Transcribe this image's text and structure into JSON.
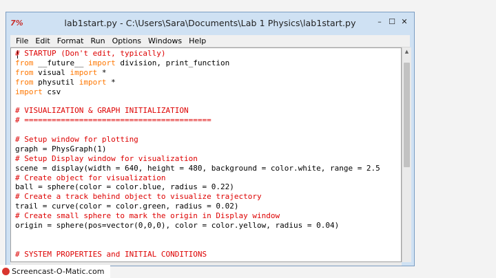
{
  "window": {
    "title": "lab1start.py - C:\\Users\\Sara\\Documents\\Lab 1 Physics\\lab1start.py",
    "app_icon_glyph": "7%",
    "controls": {
      "minimize": "–",
      "maximize": "☐",
      "close": "✕"
    }
  },
  "menubar": {
    "items": [
      "File",
      "Edit",
      "Format",
      "Run",
      "Options",
      "Windows",
      "Help"
    ]
  },
  "editor": {
    "lines": [
      [
        {
          "t": "# STARTUP (Don't edit, typically)",
          "c": "cm"
        }
      ],
      [
        {
          "t": "from",
          "c": "kw"
        },
        {
          "t": " __future__ ",
          "c": ""
        },
        {
          "t": "import",
          "c": "kw"
        },
        {
          "t": " division, print_function",
          "c": ""
        }
      ],
      [
        {
          "t": "from",
          "c": "kw"
        },
        {
          "t": " visual ",
          "c": ""
        },
        {
          "t": "import",
          "c": "kw"
        },
        {
          "t": " *",
          "c": ""
        }
      ],
      [
        {
          "t": "from",
          "c": "kw"
        },
        {
          "t": " physutil ",
          "c": ""
        },
        {
          "t": "import",
          "c": "kw"
        },
        {
          "t": " *",
          "c": ""
        }
      ],
      [
        {
          "t": "import",
          "c": "kw"
        },
        {
          "t": " csv",
          "c": ""
        }
      ],
      [],
      [
        {
          "t": "# VISUALIZATION & GRAPH INITIALIZATION",
          "c": "cm"
        }
      ],
      [
        {
          "t": "# =========================================",
          "c": "cm"
        }
      ],
      [],
      [
        {
          "t": "# Setup window for plotting",
          "c": "cm"
        }
      ],
      [
        {
          "t": "graph = PhysGraph(1)",
          "c": ""
        }
      ],
      [
        {
          "t": "# Setup Display window for visualization",
          "c": "cm"
        }
      ],
      [
        {
          "t": "scene = display(width = 640, height = 480, background = color.white, range = 2.5",
          "c": ""
        }
      ],
      [
        {
          "t": "# Create object for visualization",
          "c": "cm"
        }
      ],
      [
        {
          "t": "ball = sphere(color = color.blue, radius = 0.22)",
          "c": ""
        }
      ],
      [
        {
          "t": "# Create a track behind object to visualize trajectory",
          "c": "cm"
        }
      ],
      [
        {
          "t": "trail = curve(color = color.green, radius = 0.02)",
          "c": ""
        }
      ],
      [
        {
          "t": "# Create small sphere to mark the origin in Display window",
          "c": "cm"
        }
      ],
      [
        {
          "t": "origin = sphere(pos=vector(0,0,0), color = color.yellow, radius = 0.04)",
          "c": ""
        }
      ],
      [],
      [],
      [
        {
          "t": "# SYSTEM PROPERTIES and INITIAL CONDITIONS",
          "c": "cm"
        }
      ]
    ]
  },
  "colors": {
    "comment": "#dd0000",
    "keyword": "#ff7700",
    "titlebar": "#cfe1f3"
  },
  "watermark": {
    "text": "Screencast-O-Matic.com"
  }
}
